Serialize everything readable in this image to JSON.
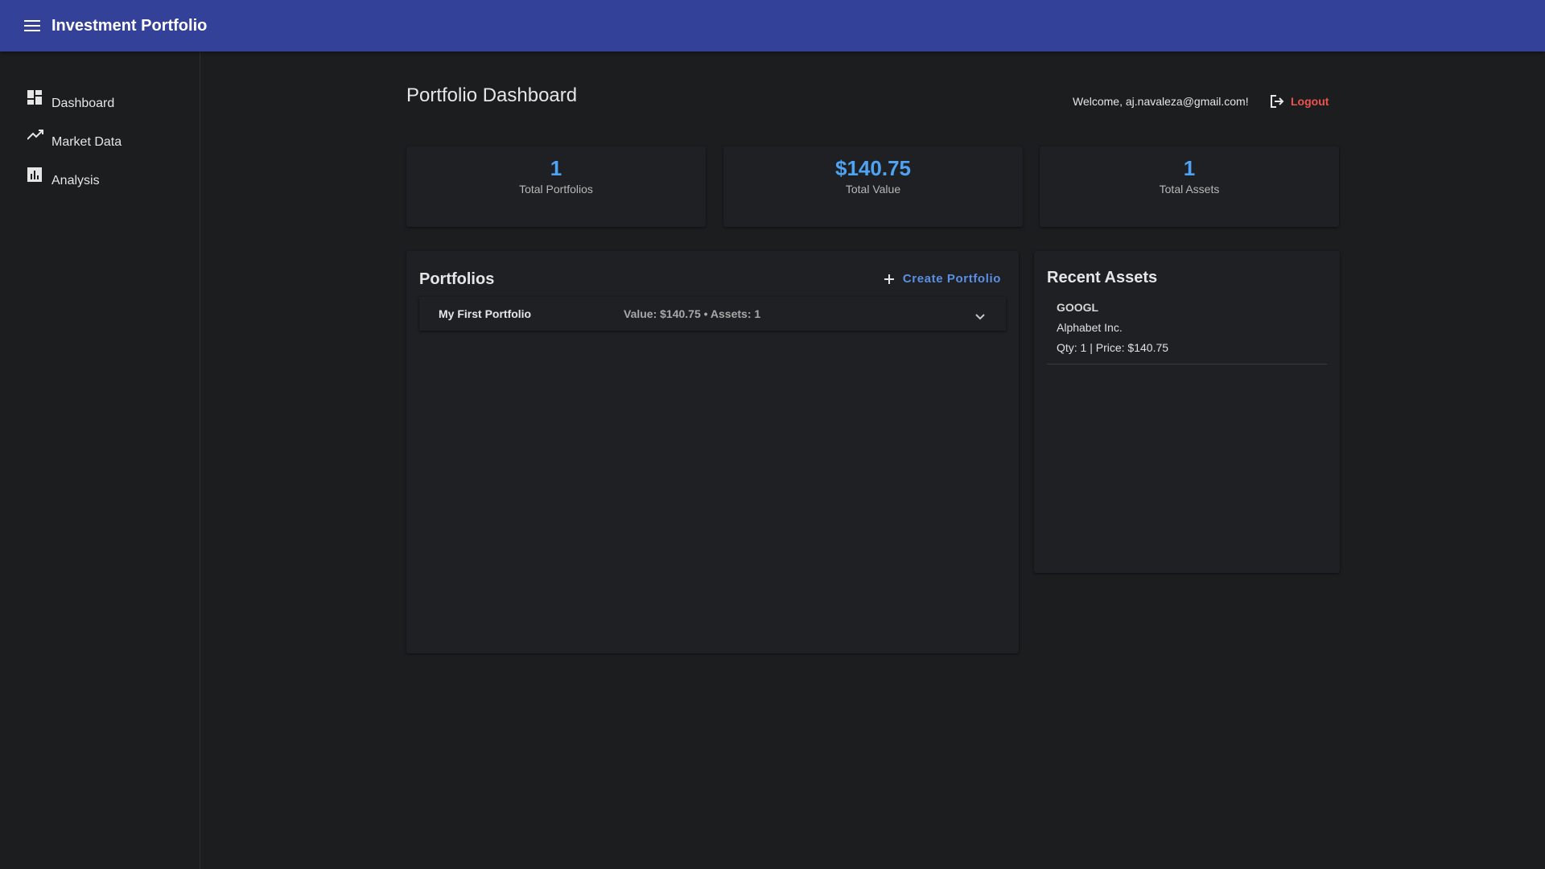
{
  "app": {
    "title": "Investment Portfolio"
  },
  "sidebar": {
    "items": [
      {
        "label": "Dashboard",
        "icon": "dashboard-icon"
      },
      {
        "label": "Market Data",
        "icon": "trending-up-icon"
      },
      {
        "label": "Analysis",
        "icon": "bar-chart-icon"
      }
    ]
  },
  "header": {
    "page_title": "Portfolio Dashboard",
    "welcome": "Welcome, aj.navaleza@gmail.com!",
    "logout_label": "Logout"
  },
  "stats": [
    {
      "value": "1",
      "label": "Total Portfolios"
    },
    {
      "value": "$140.75",
      "label": "Total Value"
    },
    {
      "value": "1",
      "label": "Total Assets"
    }
  ],
  "portfolios": {
    "title": "Portfolios",
    "create_label": "Create Portfolio",
    "items": [
      {
        "name": "My First Portfolio",
        "summary": "Value: $140.75 • Assets: 1"
      }
    ]
  },
  "recent_assets": {
    "title": "Recent Assets",
    "items": [
      {
        "symbol": "GOOGL",
        "name": "Alphabet Inc.",
        "detail": "Qty: 1 | Price: $140.75"
      }
    ]
  },
  "colors": {
    "appbar": "#344199",
    "accent_value": "#4ea3f2",
    "logout": "#ef5350",
    "create_button": "#5b8fe6",
    "background": "#1c1d1f"
  }
}
